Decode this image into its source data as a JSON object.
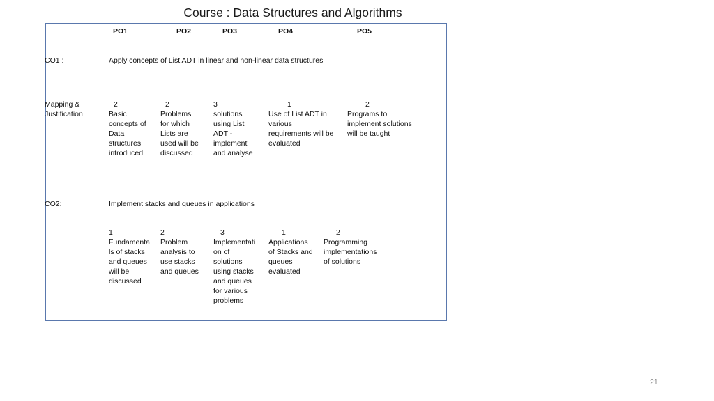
{
  "title": "Course : Data Structures and Algorithms",
  "headers": [
    "PO1",
    "PO2",
    "PO3",
    "PO4",
    "PO5"
  ],
  "co1": {
    "label": "CO1 :",
    "description": "Apply concepts of List ADT in linear and non-linear data structures",
    "mapping_label": "Mapping &\nJustification",
    "cells": [
      {
        "score": "2",
        "text": "Basic\nconcepts of\nData\nstructures\nintroduced"
      },
      {
        "score": "2",
        "text": "Problems\nfor which\nLists are\nused will be\ndiscussed"
      },
      {
        "score": "3",
        "text": "solutions\nusing List\nADT -\nimplement\nand analyse"
      },
      {
        "score": "1",
        "text": "Use of List ADT in\nvarious\nrequirements will be\nevaluated"
      },
      {
        "score": "2",
        "text": "Programs  to\nimplement solutions\nwill be taught"
      }
    ]
  },
  "co2": {
    "label": "CO2:",
    "description": "Implement stacks and queues in applications",
    "cells": [
      {
        "score": "1",
        "text": "Fundamenta\nls of stacks\nand queues\nwill be\ndiscussed"
      },
      {
        "score": "2",
        "text": "Problem\nanalysis to\nuse stacks\nand queues"
      },
      {
        "score": "3",
        "text": "Implementati\non of\nsolutions\nusing stacks\nand queues\nfor various\nproblems"
      },
      {
        "score": "1",
        "text": "Applications\nof Stacks and\nqueues\nevaluated"
      },
      {
        "score": "2",
        "text": "Programming\nimplementations\nof solutions"
      }
    ]
  },
  "page_number": "21"
}
